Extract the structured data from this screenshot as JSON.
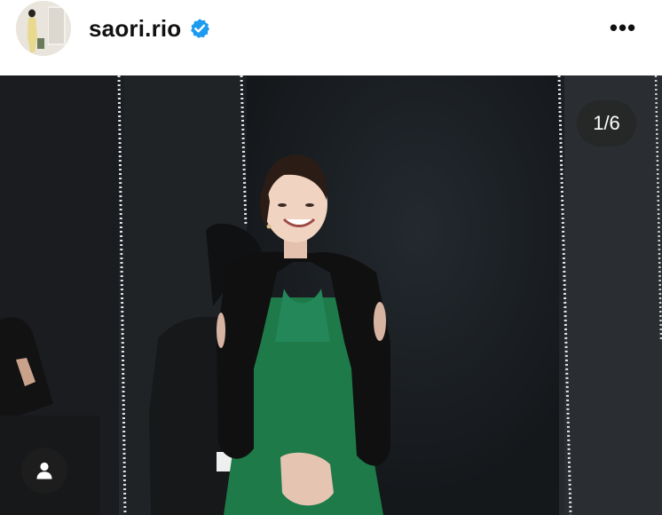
{
  "post": {
    "username": "saori.rio",
    "verified": true,
    "verified_icon": "verified-badge-icon",
    "more_icon": "more-horizontal-icon",
    "more_glyph": "•••",
    "avatar_icon": "profile-avatar"
  },
  "media": {
    "counter": "1/6",
    "tag_icon": "user-tag-icon"
  },
  "colors": {
    "verified": "#1d9bf0",
    "counter_bg": "#262626",
    "dress": "#1e7a48",
    "bolero": "#101010"
  }
}
